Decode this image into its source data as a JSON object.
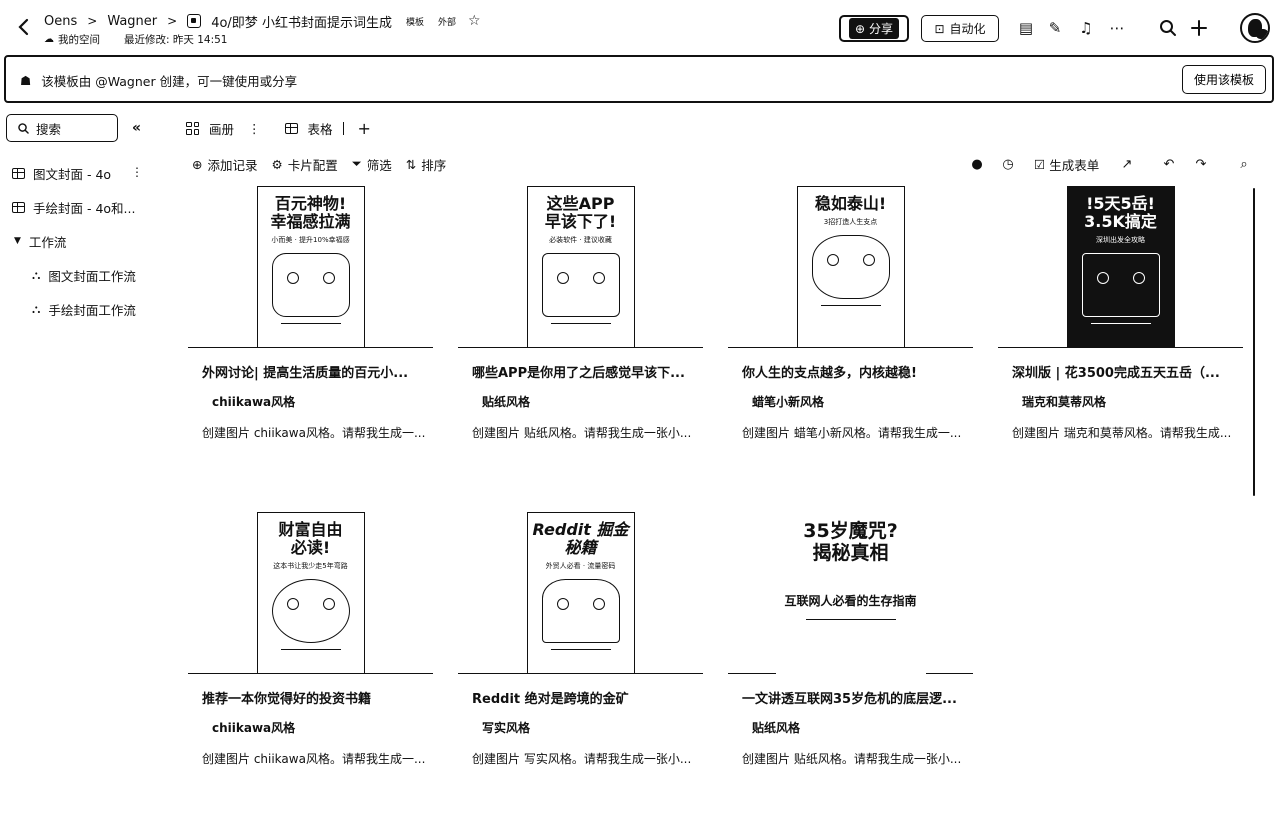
{
  "header": {
    "breadcrumbs": [
      "Oens",
      "Wagner",
      "4o/即梦 小红书封面提示词生成"
    ],
    "breadcrumb_separator": ">",
    "tags": [
      "模板",
      "外部"
    ],
    "space": "我的空间",
    "last_modified": "最近修改: 昨天 14:51",
    "share_label": "分享",
    "automation_label": "自动化"
  },
  "banner": {
    "message": "该模板由 @Wagner 创建，可一键使用或分享",
    "use_button": "使用该模板"
  },
  "sidebar": {
    "search_placeholder": "搜索",
    "items": [
      {
        "label": "图文封面 - 4o"
      },
      {
        "label": "手绘封面 - 4o和..."
      },
      {
        "label": "工作流"
      },
      {
        "label": "图文封面工作流"
      },
      {
        "label": "手绘封面工作流"
      }
    ]
  },
  "views": {
    "gallery": "画册",
    "table": "表格"
  },
  "toolbar": {
    "add_record": "添加记录",
    "card_config": "卡片配置",
    "filter": "筛选",
    "sort": "排序",
    "generate_form": "生成表单"
  },
  "cards": [
    {
      "poster_title": "百元神物!\n幸福感拉满",
      "poster_sub": "小而美 · 提升10%幸福感",
      "title": "外网讨论| 提高生活质量的百元小...",
      "tag": "chiikawa风格",
      "desc": "创建图片 chiikawa风格。请帮我生成一..."
    },
    {
      "poster_title": "这些APP\n早该下了!",
      "poster_sub": "必装软件 · 建议收藏",
      "title": "哪些APP是你用了之后感觉早该下...",
      "tag": "贴纸风格",
      "desc": "创建图片 贴纸风格。请帮我生成一张小..."
    },
    {
      "poster_title": "稳如泰山!",
      "poster_sub": "3招打造人生支点",
      "title": "你人生的支点越多，内核越稳!",
      "tag": "蜡笔小新风格",
      "desc": "创建图片 蜡笔小新风格。请帮我生成一..."
    },
    {
      "poster_title": "!5天5岳!\n3.5K搞定",
      "poster_sub": "深圳出发全攻略",
      "title": "深圳版 | 花3500完成五天五岳（...",
      "tag": "瑞克和莫蒂风格",
      "desc": "创建图片 瑞克和莫蒂风格。请帮我生成..."
    },
    {
      "poster_title": "财富自由\n必读!",
      "poster_sub": "这本书让我少走5年弯路",
      "title": "推荐一本你觉得好的投资书籍",
      "tag": "chiikawa风格",
      "desc": "创建图片 chiikawa风格。请帮我生成一..."
    },
    {
      "poster_title": "Reddit\n掘金秘籍",
      "poster_sub": "外贸人必看 · 流量密码",
      "title": "Reddit 绝对是跨境的金矿",
      "tag": "写实风格",
      "desc": "创建图片 写实风格。请帮我生成一张小..."
    },
    {
      "poster_title": "35岁魔咒?\n揭秘真相",
      "poster_sub": "互联网人必看的生存指南",
      "title": "一文讲透互联网35岁危机的底层逻...",
      "tag": "贴纸风格",
      "desc": "创建图片 贴纸风格。请帮我生成一张小..."
    }
  ]
}
